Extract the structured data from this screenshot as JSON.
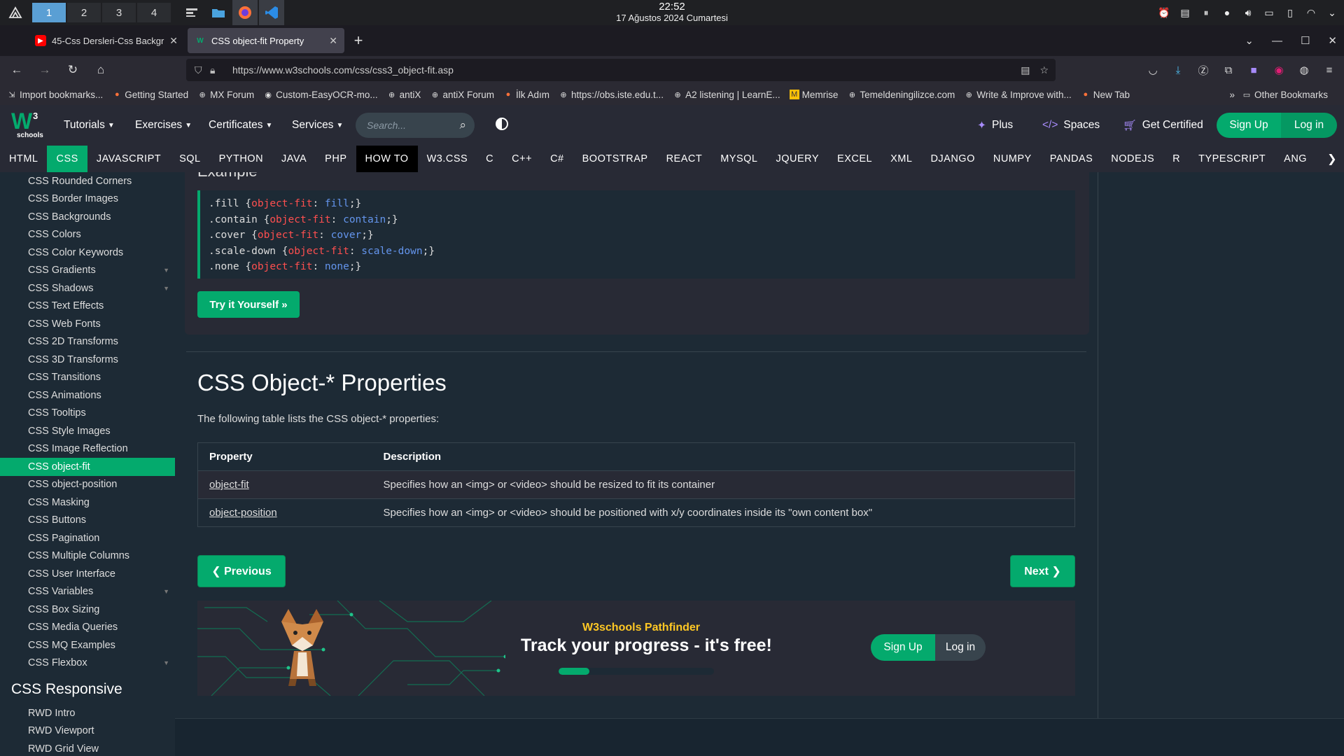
{
  "os": {
    "workspaces": [
      "1",
      "2",
      "3",
      "4"
    ],
    "clock_time": "22:52",
    "clock_date": "17 Ağustos 2024 Cumartesi"
  },
  "browser": {
    "tabs": [
      {
        "title": "45-Css Dersleri-Css Backgr"
      },
      {
        "title": "CSS object-fit Property"
      }
    ],
    "url": "https://www.w3schools.com/css/css3_object-fit.asp",
    "bookmarks": [
      "Import bookmarks...",
      "Getting Started",
      "MX Forum",
      "Custom-EasyOCR-mo...",
      "antiX",
      "antiX Forum",
      "İlk Adım",
      "https://obs.iste.edu.t...",
      "A2 listening | LearnE...",
      "Memrise",
      "Temeldeningilizce.com",
      "Write & Improve with...",
      "New Tab"
    ],
    "other_bookmarks": "Other Bookmarks"
  },
  "w3": {
    "logo_w": "W",
    "logo_3": "3",
    "logo_schools": "schools",
    "menu": [
      "Tutorials",
      "Exercises",
      "Certificates",
      "Services"
    ],
    "search_placeholder": "Search...",
    "plus": "Plus",
    "spaces": "Spaces",
    "get_certified": "Get Certified",
    "signup": "Sign Up",
    "login": "Log in",
    "topics": [
      "HTML",
      "CSS",
      "JAVASCRIPT",
      "SQL",
      "PYTHON",
      "JAVA",
      "PHP",
      "HOW TO",
      "W3.CSS",
      "C",
      "C++",
      "C#",
      "BOOTSTRAP",
      "REACT",
      "MYSQL",
      "JQUERY",
      "EXCEL",
      "XML",
      "DJANGO",
      "NUMPY",
      "PANDAS",
      "NODEJS",
      "R",
      "TYPESCRIPT",
      "ANG"
    ]
  },
  "sidebar": {
    "items": [
      "CSS Rounded Corners",
      "CSS Border Images",
      "CSS Backgrounds",
      "CSS Colors",
      "CSS Color Keywords",
      "CSS Gradients",
      "CSS Shadows",
      "CSS Text Effects",
      "CSS Web Fonts",
      "CSS 2D Transforms",
      "CSS 3D Transforms",
      "CSS Transitions",
      "CSS Animations",
      "CSS Tooltips",
      "CSS Style Images",
      "CSS Image Reflection",
      "CSS object-fit",
      "CSS object-position",
      "CSS Masking",
      "CSS Buttons",
      "CSS Pagination",
      "CSS Multiple Columns",
      "CSS User Interface",
      "CSS Variables",
      "CSS Box Sizing",
      "CSS Media Queries",
      "CSS MQ Examples",
      "CSS Flexbox"
    ],
    "section_heading": "CSS Responsive",
    "section_items": [
      "RWD Intro",
      "RWD Viewport",
      "RWD Grid View"
    ]
  },
  "main": {
    "example_title": "Example",
    "code": [
      {
        "sel": ".fill ",
        "prop": "object-fit",
        "val": "fill"
      },
      {
        "sel": ".contain ",
        "prop": "object-fit",
        "val": "contain"
      },
      {
        "sel": ".cover ",
        "prop": "object-fit",
        "val": "cover"
      },
      {
        "sel": ".scale-down ",
        "prop": "object-fit",
        "val": "scale-down"
      },
      {
        "sel": ".none ",
        "prop": "object-fit",
        "val": "none"
      }
    ],
    "try_it": "Try it Yourself »",
    "heading": "CSS Object-* Properties",
    "intro": "The following table lists the CSS object-* properties:",
    "table_headers": [
      "Property",
      "Description"
    ],
    "table_rows": [
      {
        "property": "object-fit",
        "description": "Specifies how an <img> or <video> should be resized to fit its container"
      },
      {
        "property": "object-position",
        "description": "Specifies how an <img> or <video> should be positioned with x/y coordinates inside its \"own content box\""
      }
    ],
    "previous": "❮ Previous",
    "next": "Next ❯"
  },
  "pathfinder": {
    "eyebrow": "W3schools Pathfinder",
    "title": "Track your progress - it's free!",
    "progress_fraction": 0.2,
    "signup": "Sign Up",
    "login": "Log in"
  },
  "colors": {
    "brand_green": "#04aa6d",
    "page_bg": "#1d2a35",
    "panel_bg": "#282a35"
  }
}
